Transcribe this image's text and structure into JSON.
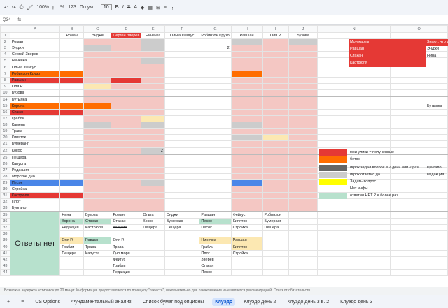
{
  "toolbar": {
    "zoom": "100%",
    "format": "123",
    "font": "По ум...",
    "size": "10",
    "currency": "р.",
    "percent": "%"
  },
  "formula": {
    "cell_ref": "Q34"
  },
  "columns": [
    "A",
    "B",
    "C",
    "D",
    "E",
    "F",
    "G",
    "H",
    "I",
    "J",
    "N",
    "O"
  ],
  "header_row": [
    "",
    "Роман",
    "Энджи",
    "Сергей Зверев",
    "Нинечка",
    "Ольга Фейгус",
    "Робинзон Крузо",
    "Равшан",
    "Оля Р.",
    "Бузова",
    "",
    ""
  ],
  "names": [
    "Роман",
    "Энджи",
    "Сергей Зверев",
    "Нинечка",
    "Ольга Фейгус",
    "Робинзон Крузо",
    "Равшан",
    "Оля Р.",
    "Бузова"
  ],
  "places": [
    "Бутылка",
    "Корона",
    "Стакан",
    "Грабли",
    "Камень",
    "Трава",
    "Кипяток",
    "Бумеранг",
    "Кокос"
  ],
  "locations": [
    "Пещера",
    "Капуста",
    "Редакция",
    "Морское дно",
    "Песок",
    "Стройка",
    "Кастрюля",
    "Плот",
    "Бунгало"
  ],
  "legend_cards": {
    "title": "Мои карты",
    "items": [
      "Равшан",
      "Стакан",
      "Кастрюля"
    ],
    "side_title": "Знают, что у",
    "side_items": [
      "Энджи",
      "Нина"
    ]
  },
  "legend_keys": [
    "мои улики = полученные",
    "бетон",
    "игрок задал вопрос в 2 день или 2 раз",
    "игрок ответил да",
    "Задать вопрос",
    "Нет инфы",
    "ответил НЕТ 2 и более раз"
  ],
  "side_places": {
    "top": "Бутылка",
    "mid1": "Бунгало",
    "mid2": "Редакция"
  },
  "answers_label": "Ответы нет",
  "answers_rows": [
    [
      "Нина",
      "Бузова",
      "Роман",
      "Ольга",
      "Энджи",
      "Равшан",
      "Фейгус",
      "Робинзон"
    ],
    [
      "Корона",
      "Стакан",
      "Стакан",
      "Кокос",
      "Бумеранг",
      "Песок",
      "Кипяток",
      "Бумеранг"
    ],
    [
      "Редакция",
      "Кастрюля",
      "Капуста",
      "Пещера",
      "Пещера",
      "Песок",
      "Стройка",
      "Пещера"
    ],
    [
      "",
      "",
      "",
      "",
      "",
      "",
      "",
      ""
    ],
    [
      "Оля Р.",
      "Равшан",
      "Оля Р.",
      "",
      "",
      "Нинечка",
      "Равшан",
      ""
    ],
    [
      "Грабли",
      "Трава",
      "Трава",
      "",
      "",
      "Грабли",
      "Кипяток",
      ""
    ],
    [
      "Пещера",
      "Капуста",
      "Дно моря",
      "",
      "",
      "Плот",
      "Стройка",
      ""
    ],
    [
      "",
      "",
      "Фейгус",
      "",
      "",
      "Зверев",
      "",
      ""
    ],
    [
      "",
      "",
      "Грабли",
      "",
      "",
      "Стакан",
      "",
      ""
    ],
    [
      "",
      "",
      "Редакция",
      "",
      "",
      "Песок",
      "",
      ""
    ]
  ],
  "footnote": "Возможна задержка котировок до 20 минут. Информация предоставляется по принципу \"как есть\", исключительно для ознакомления и не является рекомендацией. Отказ от обязательств",
  "tabs": [
    "US Options",
    "Фундаментальный анализ",
    "Список бумаг под опционы",
    "Клуэдо",
    "Клуэдо день 2",
    "Клуэдо день 3 в. 2",
    "Клуэдо день 3"
  ],
  "active_tab": "Клуэдо",
  "cell_values": {
    "row3_count": "2",
    "row22_count": "2"
  }
}
